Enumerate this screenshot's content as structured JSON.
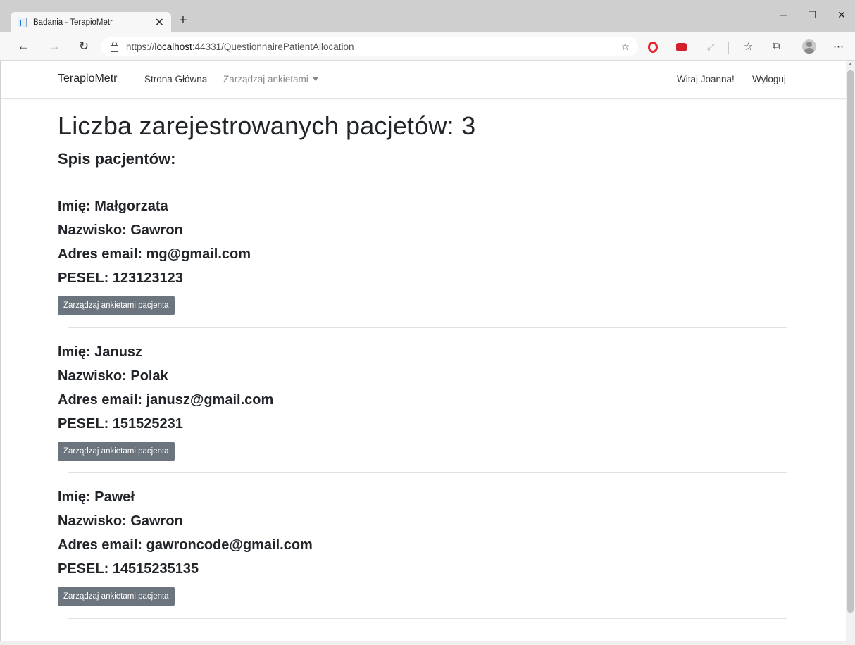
{
  "browser": {
    "tab_title": "Badania - TerapioMetr",
    "url_prefix": "https://",
    "url_host": "localhost",
    "url_rest": ":44331/QuestionnairePatientAllocation"
  },
  "nav": {
    "brand": "TerapioMetr",
    "home": "Strona Główna",
    "manage": "Zarządzaj ankietami",
    "greeting": "Witaj Joanna!",
    "logout": "Wyloguj"
  },
  "page": {
    "heading": "Liczba zarejestrowanych pacjetów: 3",
    "subheading": "Spis pacjentów:"
  },
  "patients": [
    {
      "first_name": "Imię: Małgorzata",
      "last_name": "Nazwisko: Gawron",
      "email": "Adres email: mg@gmail.com",
      "pesel": "PESEL: 123123123",
      "button": "Zarządzaj ankietami pacjenta"
    },
    {
      "first_name": "Imię: Janusz",
      "last_name": "Nazwisko: Polak",
      "email": "Adres email: janusz@gmail.com",
      "pesel": "PESEL: 151525231",
      "button": "Zarządzaj ankietami pacjenta"
    },
    {
      "first_name": "Imię: Paweł",
      "last_name": "Nazwisko: Gawron",
      "email": "Adres email: gawroncode@gmail.com",
      "pesel": "PESEL: 14515235135",
      "button": "Zarządzaj ankietami pacjenta"
    }
  ],
  "colors": {
    "button_bg": "#6c757d",
    "text": "#212529",
    "nav_muted": "#888888"
  }
}
